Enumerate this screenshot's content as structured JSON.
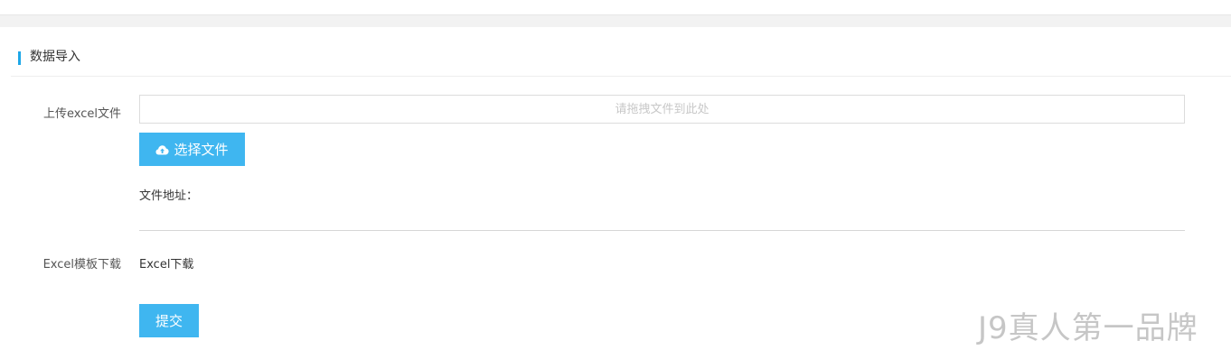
{
  "section": {
    "title": "数据导入"
  },
  "upload": {
    "label": "上传excel文件",
    "dropzone_placeholder": "请拖拽文件到此处",
    "choose_button_label": "选择文件",
    "choose_button_icon": "cloud-upload-icon",
    "file_address_label": "文件地址："
  },
  "template": {
    "label": "Excel模板下载",
    "link_text": "Excel下载"
  },
  "actions": {
    "submit_label": "提交"
  },
  "watermark": {
    "text": "J9真人第一品牌"
  },
  "colors": {
    "accent": "#1ea7e8",
    "button": "#3fb6f0"
  }
}
